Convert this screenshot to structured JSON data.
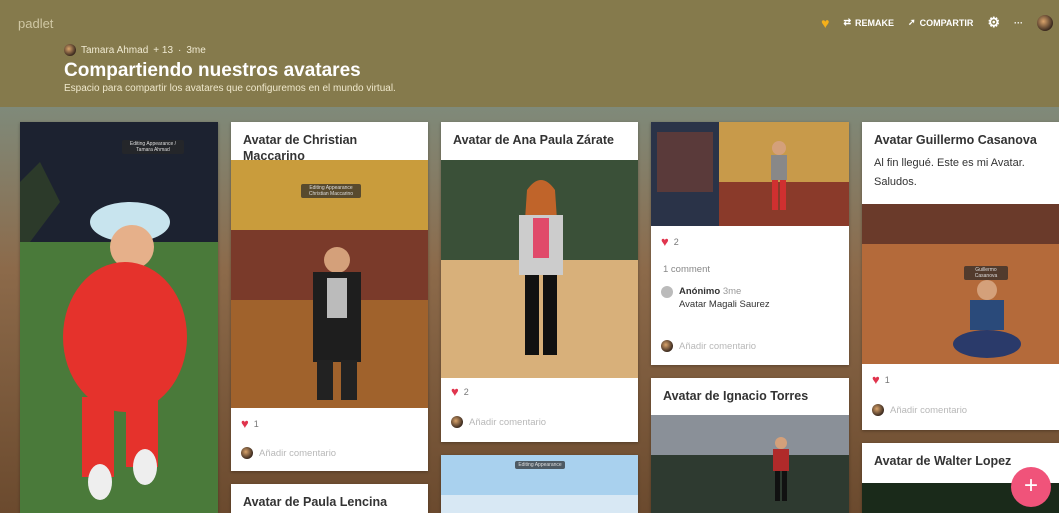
{
  "app": {
    "logo": "padlet"
  },
  "header": {
    "author": "Tamara Ahmad",
    "reactions": "+ 13",
    "age": "3me",
    "title": "Compartiendo nuestros avatares",
    "subtitle": "Espacio para compartir los avatares que configuremos en el mundo virtual."
  },
  "toolbar": {
    "remake": "REMAKE",
    "share": "COMPARTIR",
    "more": "···"
  },
  "colors": {
    "accent": "#f0537a",
    "heart": "#e0344d",
    "header_bg": "#857a4c"
  },
  "cards": {
    "c1": {
      "tag": "Editing Appearance / Tamara Ahmad"
    },
    "c2": {
      "title": "Avatar de Christian Maccarino",
      "tag": "Editing Appearance Christian Maccarino",
      "likes": "1",
      "add_comment": "Añadir comentario"
    },
    "c3": {
      "title": "Avatar de Paula Lencina"
    },
    "c4": {
      "title": "Avatar de Ana Paula Zárate",
      "likes": "2",
      "add_comment": "Añadir comentario"
    },
    "c5": {
      "tag": "Editing Appearance"
    },
    "c6": {
      "likes": "2",
      "comments": "1 comment",
      "commenter": "Anónimo",
      "comment_age": "3me",
      "comment_text": "Avatar Magali Saurez",
      "add_comment": "Añadir comentario"
    },
    "c7": {
      "title": "Avatar de Ignacio Torres"
    },
    "c8": {
      "title": "Avatar Guillermo Casanova",
      "body": "Al fin llegué. Este es mi Avatar. Saludos.",
      "tag": "Guillermo Casanova",
      "likes": "1",
      "add_comment": "Añadir comentario"
    },
    "c9": {
      "title": "Avatar de Walter Lopez"
    }
  },
  "fab": {
    "label": "+"
  }
}
